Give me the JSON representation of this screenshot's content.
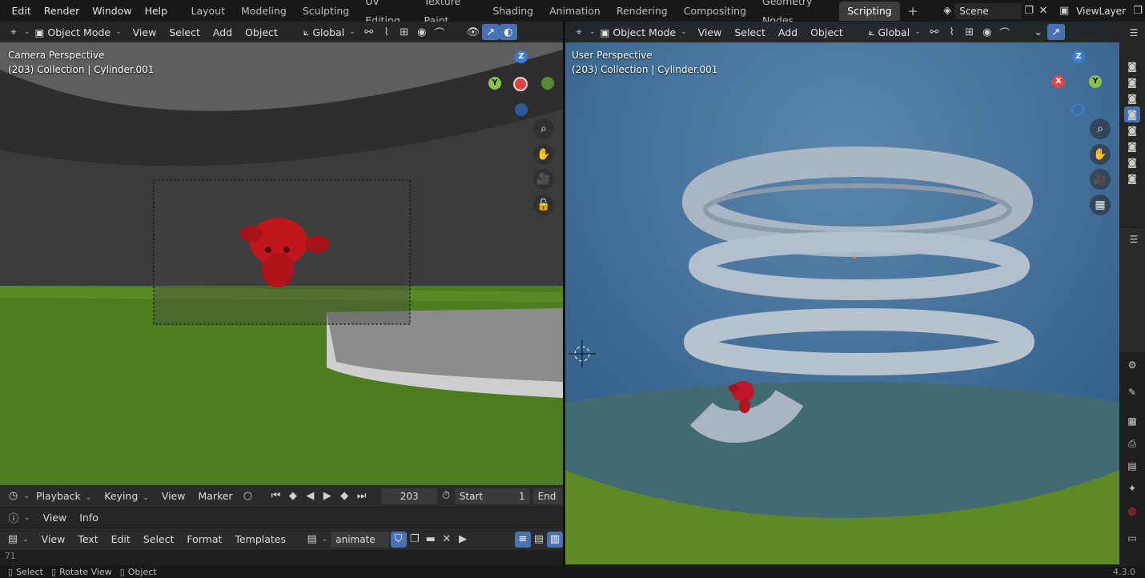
{
  "menus": [
    "Edit",
    "Render",
    "Window",
    "Help"
  ],
  "workspaces": [
    "Layout",
    "Modeling",
    "Sculpting",
    "UV Editing",
    "Texture Paint",
    "Shading",
    "Animation",
    "Rendering",
    "Compositing",
    "Geometry Nodes",
    "Scripting"
  ],
  "active_workspace": "Scripting",
  "scene": "Scene",
  "view_layer": "ViewLayer",
  "left_viewport": {
    "mode": "Object Mode",
    "menus": [
      "View",
      "Select",
      "Add",
      "Object"
    ],
    "transform": "Global",
    "perspective": "Camera Perspective",
    "collection": "(203) Collection | Cylinder.001"
  },
  "right_viewport": {
    "mode": "Object Mode",
    "menus": [
      "View",
      "Select",
      "Add",
      "Object"
    ],
    "transform": "Global",
    "perspective": "User Perspective",
    "collection": "(203) Collection | Cylinder.001"
  },
  "gizmo": {
    "x": "X",
    "y": "Y",
    "z": "Z",
    "x_color": "#e2443f",
    "y_color": "#8bc34a",
    "z_color": "#3b7dd8"
  },
  "timeline": {
    "menus": [
      "Playback",
      "Keying",
      "View",
      "Marker"
    ],
    "frame": "203",
    "start_label": "Start",
    "start_value": "1",
    "end_label": "End"
  },
  "info_bar": {
    "menus": [
      "View",
      "Info"
    ]
  },
  "text_editor": {
    "menus": [
      "View",
      "Text",
      "Edit",
      "Select",
      "Format",
      "Templates"
    ],
    "file": "animate",
    "line": "71"
  },
  "status": {
    "select": "Select",
    "rotate": "Rotate View",
    "object": "Object",
    "version": "4.3.0"
  },
  "colors": {
    "accent": "#4772b3",
    "grass": "#4e7d1f",
    "spring": "#aab6c4",
    "monkey": "#c0161c",
    "sky": "#35628e"
  }
}
